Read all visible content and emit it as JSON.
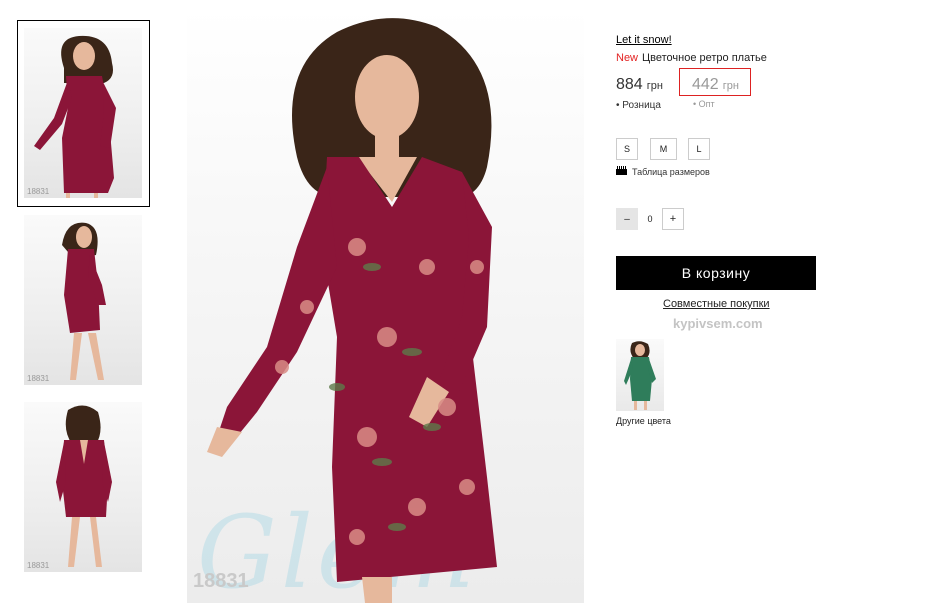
{
  "gallery": {
    "thumbnails": [
      {
        "code": "18831",
        "view": "front"
      },
      {
        "code": "18831",
        "view": "side"
      },
      {
        "code": "18831",
        "view": "back"
      }
    ],
    "main_code": "18831",
    "watermark": "Glem"
  },
  "product": {
    "brand": "Let it snow!",
    "badge": "New",
    "name": "Цветочное ретро платье",
    "price_retail": "884",
    "price_wholesale": "442",
    "currency": "грн",
    "label_retail": "Розница",
    "label_wholesale": "Опт",
    "sizes": [
      "S",
      "M",
      "L"
    ],
    "size_table_label": "Таблица размеров",
    "quantity": "0",
    "minus": "–",
    "plus": "+",
    "cart_button": "В корзину",
    "joint_purchase": "Совместные покупки",
    "site": "kypivsem.com",
    "other_colors_label": "Другие цвета"
  },
  "colors": {
    "dress": "#8b1538",
    "dress_green": "#2f7d5b",
    "hair": "#3a2518",
    "skin": "#e6b89c",
    "badge_red": "#e32222",
    "highlight_box": "#dd2222"
  }
}
